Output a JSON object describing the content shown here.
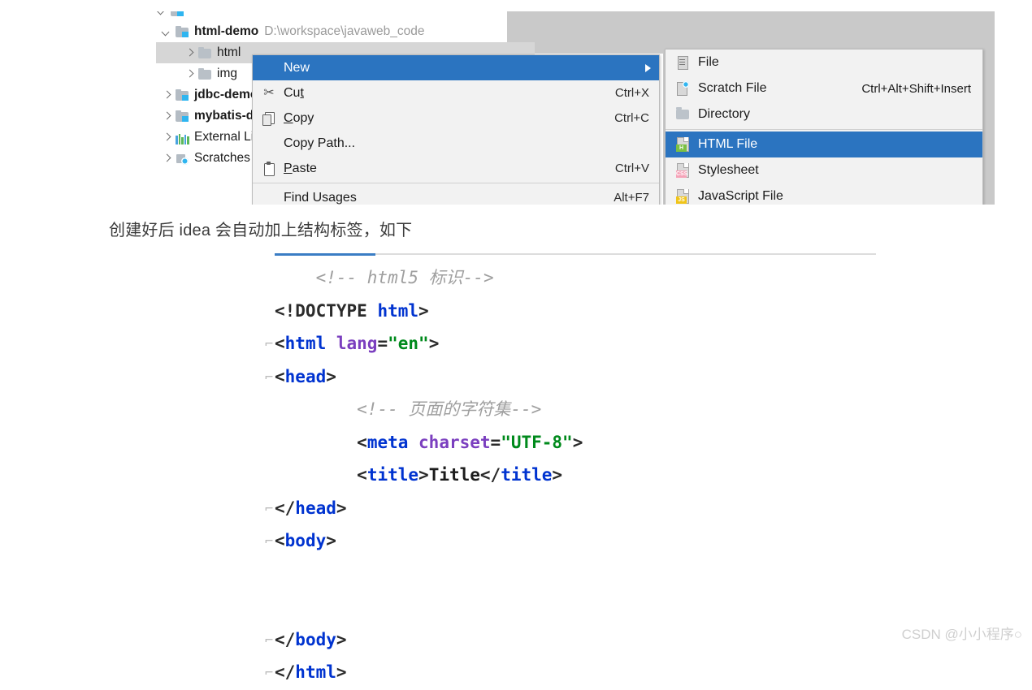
{
  "ide": {
    "tree": {
      "partial_row_note": "clipped-row-above",
      "rows": [
        {
          "arrow": "down",
          "icon": "module-folder-icon",
          "name": "html-demo",
          "path": "D:\\workspace\\javaweb_code",
          "selected": false,
          "indent": 0
        },
        {
          "arrow": "right",
          "icon": "folder-icon",
          "name": "html",
          "path": "",
          "selected": true,
          "indent": 1
        },
        {
          "arrow": "right",
          "icon": "folder-icon",
          "name": "img",
          "path": "",
          "selected": false,
          "indent": 1
        },
        {
          "arrow": "right",
          "icon": "module-folder-icon",
          "name": "jdbc-demo",
          "path": "",
          "selected": false,
          "indent": 0
        },
        {
          "arrow": "right",
          "icon": "module-folder-icon",
          "name": "mybatis-demo",
          "path": "",
          "selected": false,
          "indent": 0
        },
        {
          "arrow": "right",
          "icon": "external-libraries-icon",
          "name": "External Libraries",
          "path": "",
          "selected": false,
          "indent": 0
        },
        {
          "arrow": "right",
          "icon": "scratches-icon",
          "name": "Scratches and Consoles",
          "path": "",
          "selected": false,
          "indent": 0
        }
      ]
    },
    "context_menu": {
      "items": [
        {
          "label": "New",
          "icon": "",
          "shortcut": "",
          "highlighted": true,
          "submenu": true,
          "underline": ""
        },
        {
          "label": "Cut",
          "icon": "cut-icon",
          "shortcut": "Ctrl+X",
          "highlighted": false,
          "submenu": false,
          "underline": "t"
        },
        {
          "label": "Copy",
          "icon": "copy-icon",
          "shortcut": "Ctrl+C",
          "highlighted": false,
          "submenu": false,
          "underline": "C"
        },
        {
          "label": "Copy Path...",
          "icon": "",
          "shortcut": "",
          "highlighted": false,
          "submenu": false,
          "underline": ""
        },
        {
          "label": "Paste",
          "icon": "paste-icon",
          "shortcut": "Ctrl+V",
          "highlighted": false,
          "submenu": false,
          "underline": "P"
        },
        {
          "label": "Find Usages",
          "icon": "",
          "shortcut": "Alt+F7",
          "highlighted": false,
          "submenu": false,
          "underline": ""
        }
      ]
    },
    "submenu": {
      "items": [
        {
          "label": "File",
          "icon": "file-icon",
          "shortcut": "",
          "badge": "",
          "badge_color": "",
          "highlighted": false
        },
        {
          "label": "Scratch File",
          "icon": "scratch-file-icon",
          "shortcut": "Ctrl+Alt+Shift+Insert",
          "badge": "",
          "badge_color": "",
          "highlighted": false
        },
        {
          "label": "Directory",
          "icon": "directory-icon",
          "shortcut": "",
          "badge": "",
          "badge_color": "",
          "highlighted": false
        },
        {
          "label": "HTML File",
          "icon": "html-file-icon",
          "shortcut": "",
          "badge": "H",
          "badge_color": "#7bc043",
          "highlighted": true
        },
        {
          "label": "Stylesheet",
          "icon": "css-file-icon",
          "shortcut": "",
          "badge": "CSS",
          "badge_color": "#f5a3b8",
          "highlighted": false
        },
        {
          "label": "JavaScript File",
          "icon": "js-file-icon",
          "shortcut": "",
          "badge": "JS",
          "badge_color": "#f0c419",
          "highlighted": false
        }
      ]
    }
  },
  "caption": "创建好后 idea 会自动加上结构标签，如下",
  "code": {
    "lines": [
      {
        "fold": "",
        "indent": 1,
        "tokens": [
          {
            "t": "cm",
            "v": "<!-- html5 标识-->"
          }
        ]
      },
      {
        "fold": "",
        "indent": 0,
        "tokens": [
          {
            "t": "br",
            "v": "<!DOCTYPE "
          },
          {
            "t": "tg",
            "v": "html"
          },
          {
            "t": "br",
            "v": ">"
          }
        ]
      },
      {
        "fold": "⌐",
        "indent": 0,
        "tokens": [
          {
            "t": "br",
            "v": "<"
          },
          {
            "t": "tg",
            "v": "html "
          },
          {
            "t": "at",
            "v": "lang"
          },
          {
            "t": "br",
            "v": "="
          },
          {
            "t": "st",
            "v": "\"en\""
          },
          {
            "t": "br",
            "v": ">"
          }
        ]
      },
      {
        "fold": "⌐",
        "indent": 0,
        "tokens": [
          {
            "t": "br",
            "v": "<"
          },
          {
            "t": "tg",
            "v": "head"
          },
          {
            "t": "br",
            "v": ">"
          }
        ]
      },
      {
        "fold": "",
        "indent": 2,
        "tokens": [
          {
            "t": "cm",
            "v": "<!-- 页面的字符集-->"
          }
        ]
      },
      {
        "fold": "",
        "indent": 2,
        "tokens": [
          {
            "t": "br",
            "v": "<"
          },
          {
            "t": "tg",
            "v": "meta "
          },
          {
            "t": "at",
            "v": "charset"
          },
          {
            "t": "br",
            "v": "="
          },
          {
            "t": "st",
            "v": "\"UTF-8\""
          },
          {
            "t": "br",
            "v": ">"
          }
        ]
      },
      {
        "fold": "",
        "indent": 2,
        "tokens": [
          {
            "t": "br",
            "v": "<"
          },
          {
            "t": "tg",
            "v": "title"
          },
          {
            "t": "br",
            "v": ">"
          },
          {
            "t": "tx",
            "v": "Title"
          },
          {
            "t": "br",
            "v": "</"
          },
          {
            "t": "tg",
            "v": "title"
          },
          {
            "t": "br",
            "v": ">"
          }
        ]
      },
      {
        "fold": "⌐",
        "indent": 0,
        "tokens": [
          {
            "t": "br",
            "v": "</"
          },
          {
            "t": "tg",
            "v": "head"
          },
          {
            "t": "br",
            "v": ">"
          }
        ]
      },
      {
        "fold": "⌐",
        "indent": 0,
        "tokens": [
          {
            "t": "br",
            "v": "<"
          },
          {
            "t": "tg",
            "v": "body"
          },
          {
            "t": "br",
            "v": ">"
          }
        ]
      },
      {
        "fold": "",
        "indent": 0,
        "tokens": []
      },
      {
        "fold": "",
        "indent": 0,
        "tokens": []
      },
      {
        "fold": "⌐",
        "indent": 0,
        "tokens": [
          {
            "t": "br",
            "v": "</"
          },
          {
            "t": "tg",
            "v": "body"
          },
          {
            "t": "br",
            "v": ">"
          }
        ]
      },
      {
        "fold": "⌐",
        "indent": 0,
        "tokens": [
          {
            "t": "br",
            "v": "</"
          },
          {
            "t": "tg",
            "v": "html"
          },
          {
            "t": "br",
            "v": ">"
          }
        ]
      }
    ]
  },
  "watermark": "CSDN @小小程序○",
  "colors": {
    "menu_highlight": "#2b74c0",
    "menu_bg": "#f2f2f2",
    "tree_selection": "#d6d6d6",
    "panel_gray": "#c9c9c9",
    "rule_accent": "#3a7dc4",
    "code_tag": "#0033d0",
    "code_attr": "#7b3fbf",
    "code_string": "#008a1c",
    "code_comment": "#9f9f9f"
  }
}
